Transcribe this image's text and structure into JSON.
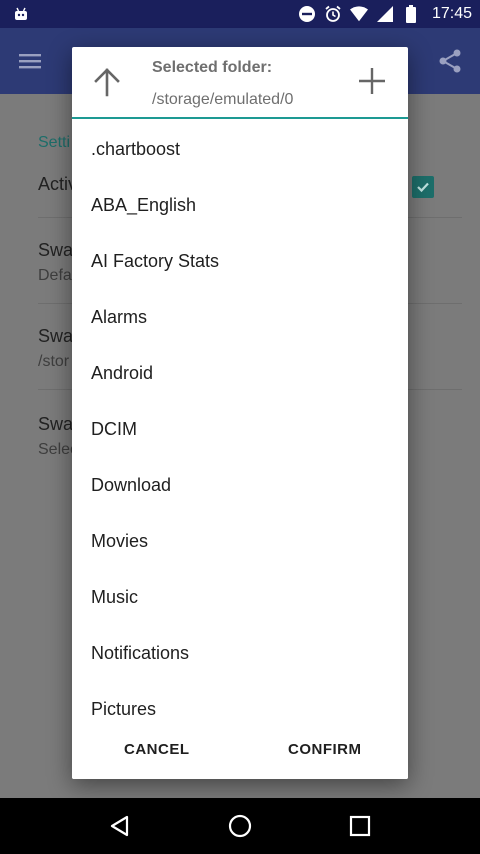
{
  "status_bar": {
    "time": "17:45",
    "icons": [
      "android-icon",
      "dnd-icon",
      "alarm-icon",
      "wifi-icon",
      "signal-icon",
      "battery-icon"
    ]
  },
  "background": {
    "section_label": "Setti",
    "rows": [
      {
        "title": "Activ",
        "subtitle": ""
      },
      {
        "title": "Swa",
        "subtitle": "Defa"
      },
      {
        "title": "Swa",
        "subtitle": "/stor"
      },
      {
        "title": "Swa",
        "subtitle": "Selec"
      }
    ]
  },
  "dialog": {
    "header_title": "Selected folder:",
    "current_path": "/storage/emulated/0",
    "folders": [
      ".chartboost",
      "ABA_English",
      "AI Factory Stats",
      "Alarms",
      "Android",
      "DCIM",
      "Download",
      "Movies",
      "Music",
      "Notifications",
      "Pictures"
    ],
    "cancel_label": "CANCEL",
    "confirm_label": "CONFIRM"
  },
  "colors": {
    "accent": "#1d9a93",
    "status_bar": "#1a1f5c",
    "app_bar": "#2d3a75"
  }
}
